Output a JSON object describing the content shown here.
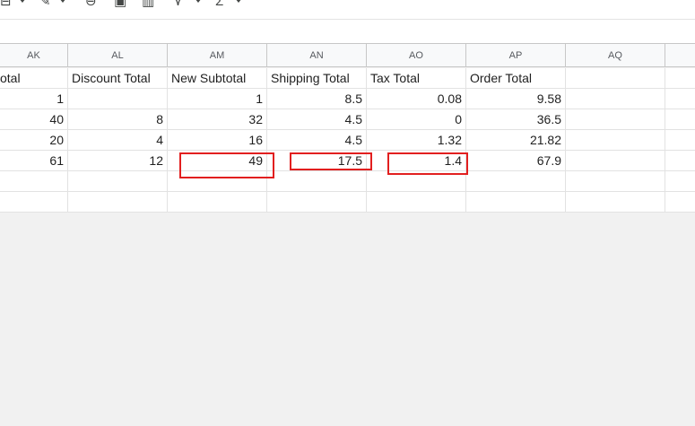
{
  "toolbar": {
    "icons": [
      "format-icon",
      "paint-format-icon",
      "link-icon",
      "comment-icon",
      "chart-icon",
      "filter-icon",
      "functions-icon"
    ]
  },
  "columns": [
    "AK",
    "AL",
    "AM",
    "AN",
    "AO",
    "AP",
    "AQ"
  ],
  "header_row": [
    "otal",
    "Discount Total",
    "New Subtotal",
    "Shipping Total",
    "Tax Total",
    "Order Total",
    ""
  ],
  "rows": [
    [
      "1",
      "",
      "1",
      "8.5",
      "0.08",
      "9.58",
      ""
    ],
    [
      "40",
      "8",
      "32",
      "4.5",
      "0",
      "36.5",
      ""
    ],
    [
      "20",
      "4",
      "16",
      "4.5",
      "1.32",
      "21.82",
      ""
    ],
    [
      "61",
      "12",
      "49",
      "17.5",
      "1.4",
      "67.9",
      ""
    ],
    [
      "",
      "",
      "",
      "",
      "",
      "",
      ""
    ],
    [
      "",
      "",
      "",
      "",
      "",
      "",
      ""
    ]
  ],
  "colors": {
    "highlight": "#e21f1f"
  }
}
